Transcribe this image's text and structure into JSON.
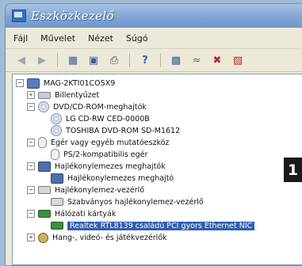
{
  "window": {
    "title": "Eszközkezelő"
  },
  "menu": [
    "Fájl",
    "Művelet",
    "Nézet",
    "Súgó"
  ],
  "toolbar": {
    "buttons": [
      "back-icon",
      "forward-icon",
      "properties-icon",
      "computer-icon",
      "print-icon",
      "help-icon",
      "scan-icon",
      "uninstall-icon",
      "remove-icon",
      "update-icon"
    ]
  },
  "tree": {
    "root": "MAG-2KTI01COSX9",
    "items": [
      {
        "label": "Billentyűzet",
        "expander": "+",
        "icon": "keyboard-icon"
      },
      {
        "label": "DVD/CD-ROM-meghajtók",
        "expander": "−",
        "icon": "disc-icon"
      },
      {
        "label": "LG CD-RW CED-0000B",
        "icon": "disc-icon"
      },
      {
        "label": "TOSHIBA DVD-ROM SD-M1612",
        "icon": "disc-icon"
      },
      {
        "label": "Egér vagy egyéb mutatóeszköz",
        "expander": "−",
        "icon": "mouse-icon"
      },
      {
        "label": "PS/2-kompatibilis egér",
        "icon": "mouse-icon"
      },
      {
        "label": "Hajlékonylemezes meghajtók",
        "expander": "−",
        "icon": "floppy-icon"
      },
      {
        "label": "Hajlékonylemezes meghajtó",
        "icon": "floppy-icon"
      },
      {
        "label": "Hajlékonylemez-vezérlő",
        "expander": "−",
        "icon": "controller-icon"
      },
      {
        "label": "Szabványos hajlékonylemez-vezérlő",
        "icon": "controller-icon"
      },
      {
        "label": "Hálózati kártyák",
        "expander": "−",
        "icon": "network-card-icon"
      },
      {
        "label": "Realtek RTL8139 családú PCI gyors Ethernet NIC",
        "icon": "network-card-icon",
        "selected": true
      },
      {
        "label": "Hang-, videó- és játékvezérlők",
        "expander": "+",
        "icon": "sound-icon"
      }
    ]
  },
  "badge": {
    "text": "1"
  }
}
